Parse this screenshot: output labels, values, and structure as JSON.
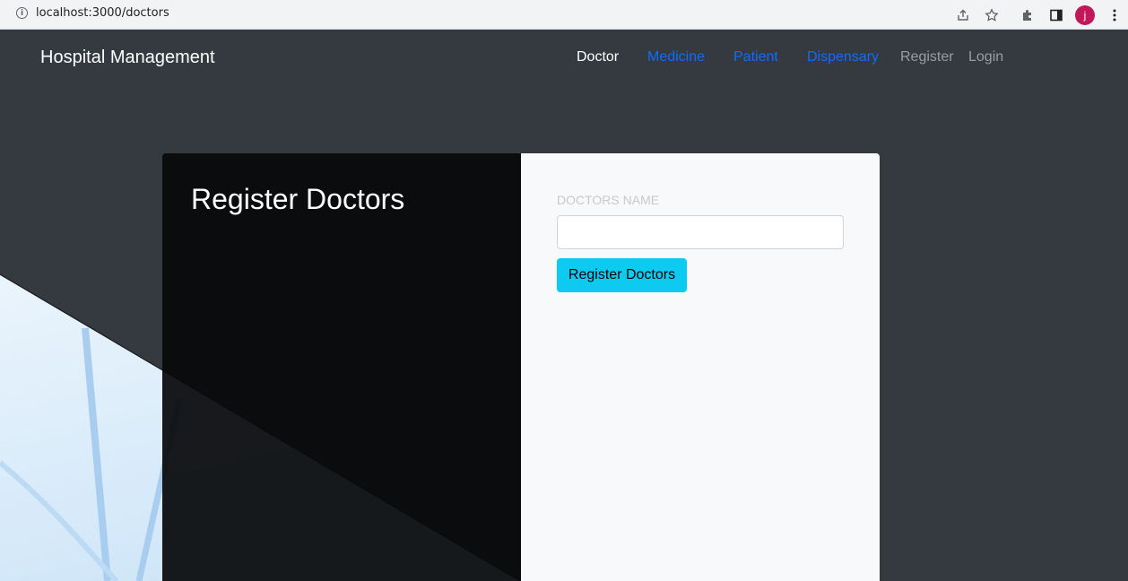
{
  "browser": {
    "url": "localhost:3000/doctors",
    "avatar_letter": "j",
    "avatar_color": "#c2185b"
  },
  "navbar": {
    "brand": "Hospital Management",
    "links": [
      {
        "label": "Doctor",
        "color": "#ffffff"
      },
      {
        "label": "Medicine",
        "color": "#0d6efd"
      },
      {
        "label": "Patient",
        "color": "#0d6efd"
      },
      {
        "label": "Dispensary",
        "color": "#0d6efd"
      },
      {
        "label": "Register",
        "color": "#9a9da0"
      },
      {
        "label": "Login",
        "color": "#9a9da0"
      }
    ]
  },
  "card": {
    "title": "Register Doctors",
    "field_label": "DOCTORS NAME",
    "field_value": "",
    "field_placeholder": "",
    "submit_label": "Register Doctors",
    "submit_color": "#0dcaf0"
  },
  "icons": [
    "info-icon",
    "share-icon",
    "star-icon",
    "extensions-icon",
    "side-panel-icon",
    "avatar",
    "kebab-menu-icon"
  ]
}
